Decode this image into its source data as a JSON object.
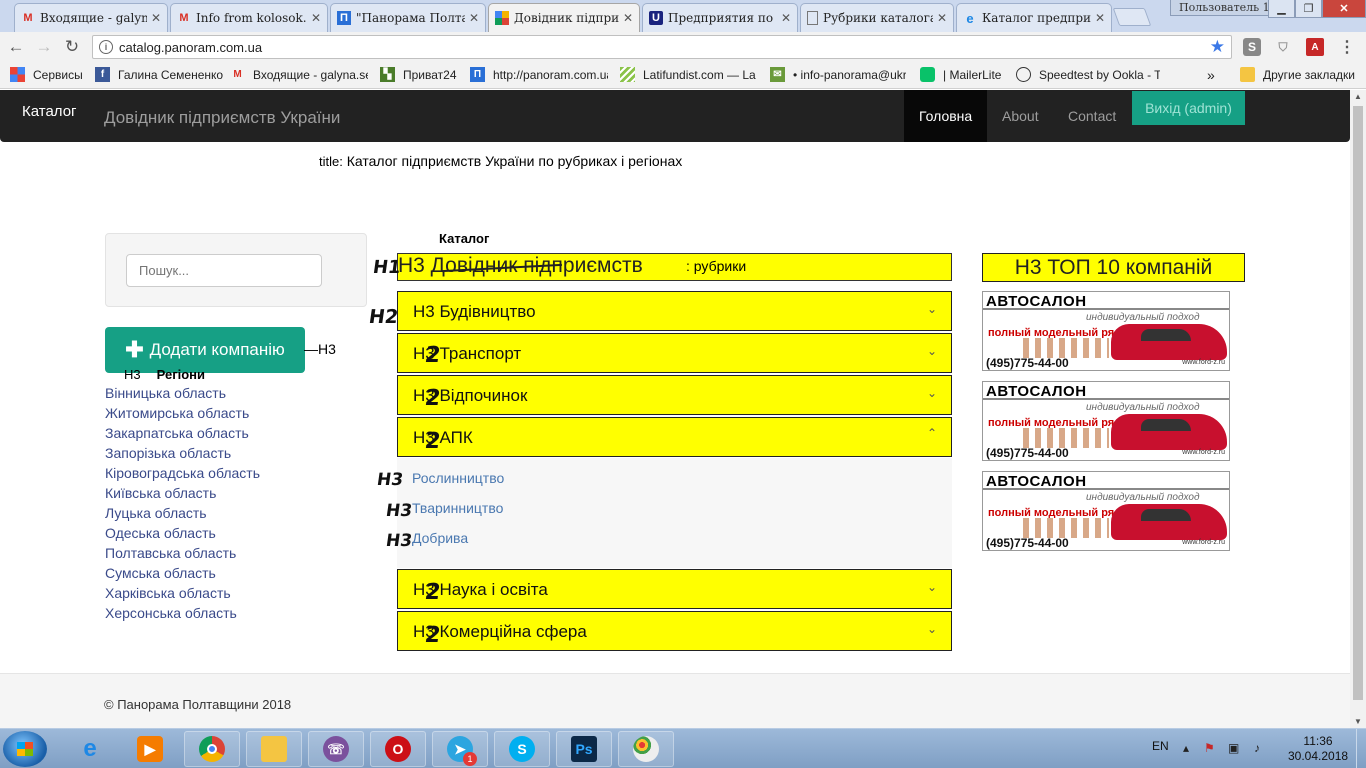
{
  "browser": {
    "tabs": [
      {
        "title": "Входящие - galyna",
        "icon": "gmail-icon",
        "active": false
      },
      {
        "title": "Info from kolosok.i",
        "icon": "gmail-icon",
        "active": false
      },
      {
        "title": "\"Панорама Полтав",
        "icon": "panorama-icon",
        "active": false
      },
      {
        "title": "Довідник підприєм",
        "icon": "catalog-icon",
        "active": true
      },
      {
        "title": "Предприятия по об",
        "icon": "u-icon",
        "active": false
      },
      {
        "title": "Рубрики каталога",
        "icon": "page-icon",
        "active": false
      },
      {
        "title": "Каталог предприят",
        "icon": "ie-icon",
        "active": false
      }
    ],
    "user_button": "Пользователь 1",
    "url": "catalog.panoram.com.ua",
    "bookmarks": [
      {
        "label": "Сервисы",
        "icon": "apps-icon"
      },
      {
        "label": "Галина Семененко",
        "icon": "facebook-icon"
      },
      {
        "label": "Входящие - galyna.se",
        "icon": "gmail-icon"
      },
      {
        "label": "Приват24",
        "icon": "privat-icon"
      },
      {
        "label": "http://panoram.com.ua",
        "icon": "panorama-icon"
      },
      {
        "label": "Latifundist.com — La",
        "icon": "latifundist-icon"
      },
      {
        "label": "• info-panorama@ukr",
        "icon": "mail-icon"
      },
      {
        "label": "| MailerLite",
        "icon": "mailerlite-icon"
      },
      {
        "label": "Speedtest by Ookla - T",
        "icon": "speedtest-icon"
      }
    ],
    "bookmarks_more": "»",
    "other_bookmarks": "Другие закладки"
  },
  "site": {
    "brand": "Каталог",
    "brand_subtitle": "Довідник підприємств України",
    "nav": [
      {
        "label": "Головна",
        "active": true
      },
      {
        "label": "About",
        "active": false
      },
      {
        "label": "Contact",
        "active": false
      }
    ],
    "logout_label": "Вихід (admin)",
    "title_prefix": "title:",
    "title_text": "Каталог підприємств України по рубриках і регіонах",
    "search_placeholder": "Пошук...",
    "add_company_label": "Додати компанію",
    "add_company_tag": "—H3",
    "regions_prefix": "H3",
    "regions_heading": "Регіони",
    "regions": [
      "Вінницька область",
      "Житомирська область",
      "Закарпатська область",
      "Запорізька область",
      "Кіровоградська область",
      "Київська область",
      "Луцька область",
      "Одеська область",
      "Полтавська область",
      "Сумська область",
      "Харківська область",
      "Херсонська область"
    ],
    "catalog_label": "Каталог",
    "catalog_heading": "H3 Довідник підприємств",
    "catalog_heading_suffix": ": рубрики",
    "categories_top": [
      {
        "label": "H3 Будівництво",
        "expanded": false
      },
      {
        "label": "H3 Транспорт",
        "expanded": false
      },
      {
        "label": "H3 Відпочинок",
        "expanded": false
      },
      {
        "label": "H3 АПК",
        "expanded": true
      }
    ],
    "subcategories": [
      "Рослинництво",
      "Тваринництво",
      "Добрива"
    ],
    "categories_bottom": [
      {
        "label": "H3 Наука і освіта",
        "expanded": false
      },
      {
        "label": "H3 Комерційна сфера",
        "expanded": false
      }
    ],
    "top_heading": "H3 ТОП 10 компаній",
    "ads": [
      {
        "title": "АВТОСАЛОН",
        "tagline": "индивидуальный подход",
        "text": "полный модельный ряд",
        "phone": "(495)775-44-00",
        "site": "www.ford-z.ru"
      },
      {
        "title": "АВТОСАЛОН",
        "tagline": "индивидуальный подход",
        "text": "полный модельный ряд",
        "phone": "(495)775-44-00",
        "site": "www.ford-z.ru"
      },
      {
        "title": "АВТОСАЛОН",
        "tagline": "индивидуальный подход",
        "text": "полный модельный ряд",
        "phone": "(495)775-44-00",
        "site": "www.ford-z.ru"
      }
    ],
    "footer": "© Панорама Полтавщини 2018"
  },
  "annotations": {
    "h1_mark": "H1",
    "h2_mark": "H2",
    "h3_mark": "H3",
    "two_mark": "2"
  },
  "taskbar": {
    "language": "EN",
    "time": "11:36",
    "date": "30.04.2018",
    "telegram_badge": "1"
  },
  "colors": {
    "accent": "#16a085",
    "highlight": "#ffff00",
    "navbar": "#222222",
    "link": "#4a78b0"
  }
}
